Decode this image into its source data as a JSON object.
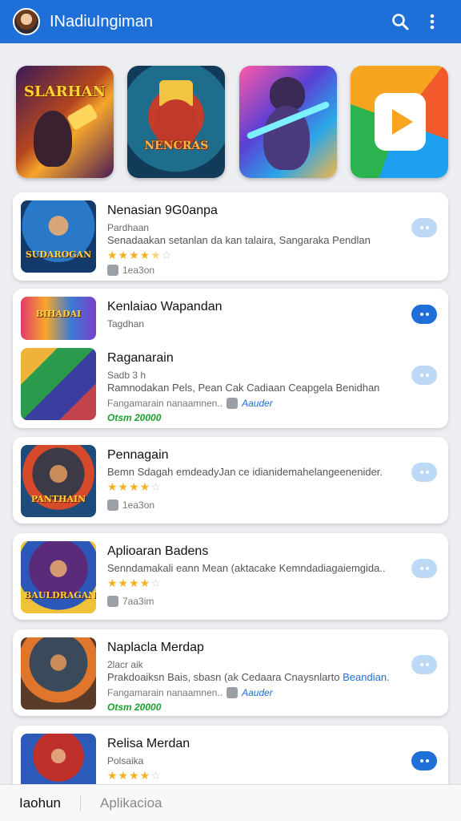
{
  "header": {
    "title": "INadiuIngiman",
    "search_icon": "search-icon",
    "menu_icon": "more-vert-icon",
    "color": "#1f6fd8"
  },
  "featured": [
    {
      "label": "SLARHAN",
      "caption": ""
    },
    {
      "label": "",
      "caption": "NENCRAS"
    },
    {
      "label": "",
      "caption": ""
    },
    {
      "label": "",
      "caption": ""
    }
  ],
  "apps": [
    {
      "name": "Nenasian 9G0anpa",
      "sub": "Pardhaan",
      "desc": "Senadaakan setanlan da kan talaira, Sangaraka Pendlan",
      "rating": 4.5,
      "meta": "1ea3on",
      "button_active": false,
      "thumb_label": "SUDAROGAN"
    },
    {
      "name": "Kenlaiao Wapandan",
      "sub": "Tagdhan",
      "desc": "",
      "rating": null,
      "meta": "",
      "button_active": true,
      "thumb_label": "BIHADAI"
    },
    {
      "name": "Raganarain",
      "sub": "Sadb 3 h",
      "desc": "Ramnodakan Pels, Pean Cak Cadiaan Ceapgela Benidhan",
      "rating": null,
      "meta": "Fangamarain nanaamnen..",
      "meta_link": "Aauder",
      "green": "Otsm 20000",
      "button_active": false,
      "thumb_label": ""
    },
    {
      "name": "Pennagain",
      "sub": "",
      "desc": "Bemn Sdagah emdeadyJan ce idianidemahelangeenenider.",
      "rating": 4,
      "meta": "1ea3on",
      "button_active": false,
      "thumb_label": "PANTHAIN"
    },
    {
      "name": "Aplioaran Badens",
      "sub": "",
      "desc": "Senndamakali eann Mean (aktacake Kemndadiagaiemgida..",
      "rating": 4,
      "meta": "7aa3im",
      "button_active": false,
      "thumb_label": "BAULDRAGAN"
    },
    {
      "name": "Naplacla Merdap",
      "sub": "2lacr aik",
      "desc": "Prakdoaiksn Bais, sbasn (ak Cedaara Cnaysnlarto",
      "desc_link": "Beandian.",
      "rating": null,
      "meta": "Fangamarain nanaamnen..",
      "meta_link": "Aauder",
      "green": "Otsm 20000",
      "button_active": false,
      "thumb_label": ""
    },
    {
      "name": "Relisa Merdan",
      "sub": "Polsaika",
      "desc": "",
      "rating": 4,
      "meta": "",
      "button_active": true,
      "thumb_label": ""
    }
  ],
  "bottom_nav": [
    {
      "label": "Iaohun"
    },
    {
      "label": "Aplikacioa"
    }
  ]
}
